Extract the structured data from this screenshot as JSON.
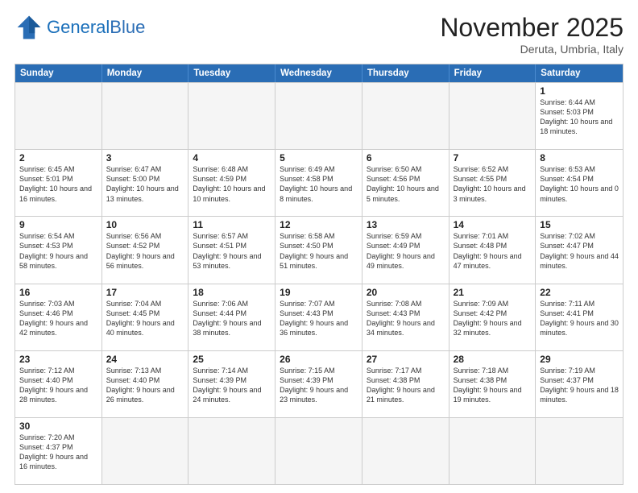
{
  "header": {
    "logo_general": "General",
    "logo_blue": "Blue",
    "month_title": "November 2025",
    "location": "Deruta, Umbria, Italy"
  },
  "days_of_week": [
    "Sunday",
    "Monday",
    "Tuesday",
    "Wednesday",
    "Thursday",
    "Friday",
    "Saturday"
  ],
  "rows": [
    [
      {
        "day": "",
        "text": ""
      },
      {
        "day": "",
        "text": ""
      },
      {
        "day": "",
        "text": ""
      },
      {
        "day": "",
        "text": ""
      },
      {
        "day": "",
        "text": ""
      },
      {
        "day": "",
        "text": ""
      },
      {
        "day": "1",
        "text": "Sunrise: 6:44 AM\nSunset: 5:03 PM\nDaylight: 10 hours\nand 18 minutes."
      }
    ],
    [
      {
        "day": "2",
        "text": "Sunrise: 6:45 AM\nSunset: 5:01 PM\nDaylight: 10 hours\nand 16 minutes."
      },
      {
        "day": "3",
        "text": "Sunrise: 6:47 AM\nSunset: 5:00 PM\nDaylight: 10 hours\nand 13 minutes."
      },
      {
        "day": "4",
        "text": "Sunrise: 6:48 AM\nSunset: 4:59 PM\nDaylight: 10 hours\nand 10 minutes."
      },
      {
        "day": "5",
        "text": "Sunrise: 6:49 AM\nSunset: 4:58 PM\nDaylight: 10 hours\nand 8 minutes."
      },
      {
        "day": "6",
        "text": "Sunrise: 6:50 AM\nSunset: 4:56 PM\nDaylight: 10 hours\nand 5 minutes."
      },
      {
        "day": "7",
        "text": "Sunrise: 6:52 AM\nSunset: 4:55 PM\nDaylight: 10 hours\nand 3 minutes."
      },
      {
        "day": "8",
        "text": "Sunrise: 6:53 AM\nSunset: 4:54 PM\nDaylight: 10 hours\nand 0 minutes."
      }
    ],
    [
      {
        "day": "9",
        "text": "Sunrise: 6:54 AM\nSunset: 4:53 PM\nDaylight: 9 hours\nand 58 minutes."
      },
      {
        "day": "10",
        "text": "Sunrise: 6:56 AM\nSunset: 4:52 PM\nDaylight: 9 hours\nand 56 minutes."
      },
      {
        "day": "11",
        "text": "Sunrise: 6:57 AM\nSunset: 4:51 PM\nDaylight: 9 hours\nand 53 minutes."
      },
      {
        "day": "12",
        "text": "Sunrise: 6:58 AM\nSunset: 4:50 PM\nDaylight: 9 hours\nand 51 minutes."
      },
      {
        "day": "13",
        "text": "Sunrise: 6:59 AM\nSunset: 4:49 PM\nDaylight: 9 hours\nand 49 minutes."
      },
      {
        "day": "14",
        "text": "Sunrise: 7:01 AM\nSunset: 4:48 PM\nDaylight: 9 hours\nand 47 minutes."
      },
      {
        "day": "15",
        "text": "Sunrise: 7:02 AM\nSunset: 4:47 PM\nDaylight: 9 hours\nand 44 minutes."
      }
    ],
    [
      {
        "day": "16",
        "text": "Sunrise: 7:03 AM\nSunset: 4:46 PM\nDaylight: 9 hours\nand 42 minutes."
      },
      {
        "day": "17",
        "text": "Sunrise: 7:04 AM\nSunset: 4:45 PM\nDaylight: 9 hours\nand 40 minutes."
      },
      {
        "day": "18",
        "text": "Sunrise: 7:06 AM\nSunset: 4:44 PM\nDaylight: 9 hours\nand 38 minutes."
      },
      {
        "day": "19",
        "text": "Sunrise: 7:07 AM\nSunset: 4:43 PM\nDaylight: 9 hours\nand 36 minutes."
      },
      {
        "day": "20",
        "text": "Sunrise: 7:08 AM\nSunset: 4:43 PM\nDaylight: 9 hours\nand 34 minutes."
      },
      {
        "day": "21",
        "text": "Sunrise: 7:09 AM\nSunset: 4:42 PM\nDaylight: 9 hours\nand 32 minutes."
      },
      {
        "day": "22",
        "text": "Sunrise: 7:11 AM\nSunset: 4:41 PM\nDaylight: 9 hours\nand 30 minutes."
      }
    ],
    [
      {
        "day": "23",
        "text": "Sunrise: 7:12 AM\nSunset: 4:40 PM\nDaylight: 9 hours\nand 28 minutes."
      },
      {
        "day": "24",
        "text": "Sunrise: 7:13 AM\nSunset: 4:40 PM\nDaylight: 9 hours\nand 26 minutes."
      },
      {
        "day": "25",
        "text": "Sunrise: 7:14 AM\nSunset: 4:39 PM\nDaylight: 9 hours\nand 24 minutes."
      },
      {
        "day": "26",
        "text": "Sunrise: 7:15 AM\nSunset: 4:39 PM\nDaylight: 9 hours\nand 23 minutes."
      },
      {
        "day": "27",
        "text": "Sunrise: 7:17 AM\nSunset: 4:38 PM\nDaylight: 9 hours\nand 21 minutes."
      },
      {
        "day": "28",
        "text": "Sunrise: 7:18 AM\nSunset: 4:38 PM\nDaylight: 9 hours\nand 19 minutes."
      },
      {
        "day": "29",
        "text": "Sunrise: 7:19 AM\nSunset: 4:37 PM\nDaylight: 9 hours\nand 18 minutes."
      }
    ],
    [
      {
        "day": "30",
        "text": "Sunrise: 7:20 AM\nSunset: 4:37 PM\nDaylight: 9 hours\nand 16 minutes."
      },
      {
        "day": "",
        "text": ""
      },
      {
        "day": "",
        "text": ""
      },
      {
        "day": "",
        "text": ""
      },
      {
        "day": "",
        "text": ""
      },
      {
        "day": "",
        "text": ""
      },
      {
        "day": "",
        "text": ""
      }
    ]
  ]
}
